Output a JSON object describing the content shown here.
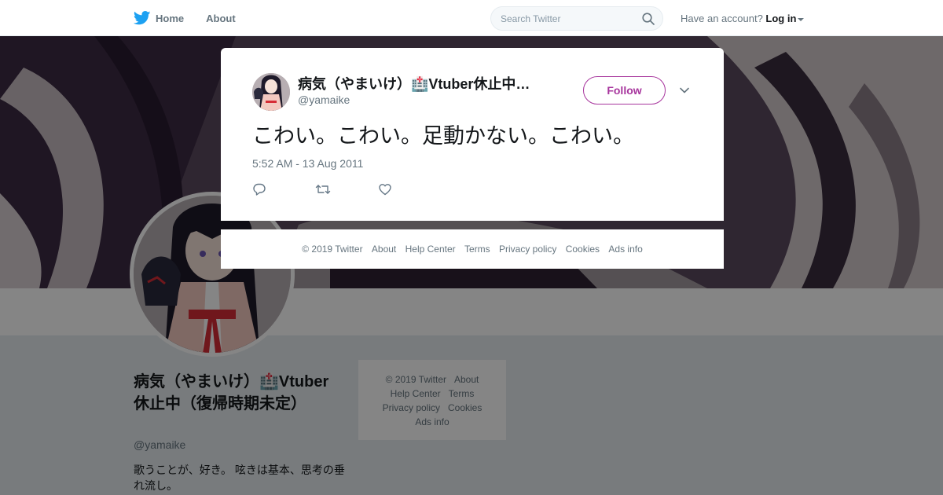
{
  "topnav": {
    "home_label": "Home",
    "about_label": "About",
    "search_placeholder": "Search Twitter",
    "account_prompt": "Have an account?",
    "login_label": "Log in",
    "brand_color": "#1da1f2"
  },
  "profile": {
    "name": "病気（やまいけ）🏥Vtuber休止中（復帰時期未定）",
    "handle": "@yamaike",
    "bio": "歌うことが、好き。 呟きは基本、思考の垂れ流し。"
  },
  "side_footer": {
    "links": [
      "© 2019 Twitter",
      "About",
      "Help Center",
      "Terms",
      "Privacy policy",
      "Cookies",
      "Ads info"
    ]
  },
  "tweet": {
    "display_name": "病気（やまいけ）🏥Vtuber休止中…",
    "handle": "@yamaike",
    "follow_label": "Follow",
    "text": "こわい。こわい。足動かない。こわい。",
    "timestamp": "5:52 AM - 13 Aug 2011",
    "accent_color": "#a7359d",
    "actions": [
      "reply-icon",
      "retweet-icon",
      "like-icon"
    ]
  },
  "modal_footer": {
    "links": [
      "© 2019 Twitter",
      "About",
      "Help Center",
      "Terms",
      "Privacy policy",
      "Cookies",
      "Ads info"
    ]
  }
}
